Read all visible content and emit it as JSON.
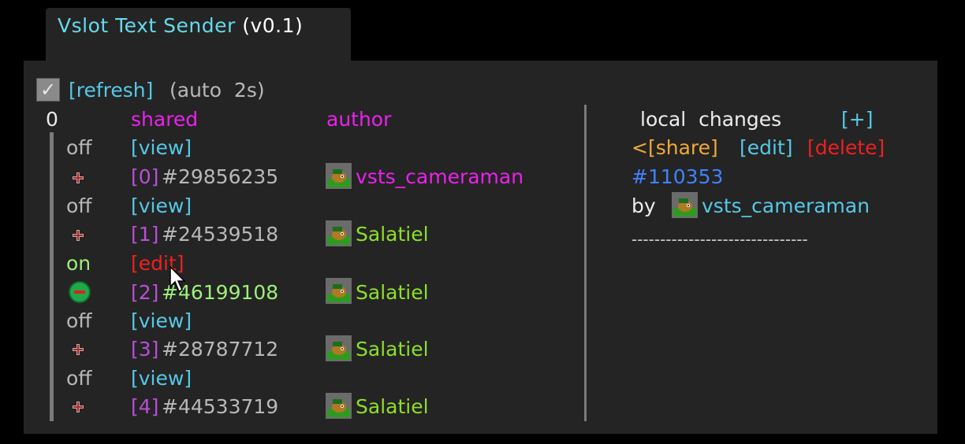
{
  "window": {
    "title": "Vslot Text Sender",
    "version": "(v0.1)"
  },
  "toolbar": {
    "refresh_label": "[refresh]",
    "auto_label": "(auto  2s)"
  },
  "list": {
    "index_label": "0",
    "header_shared": "shared",
    "header_author": "author",
    "rows": [
      {
        "state": "off",
        "action": "[view]",
        "slot": "[0]",
        "id": "#29856235",
        "author": "vsts_cameraman",
        "button": "plus-icon"
      },
      {
        "state": "off",
        "action": "[view]",
        "slot": "[1]",
        "id": "#24539518",
        "author": "Salatiel",
        "button": "plus-icon"
      },
      {
        "state": "on",
        "action": "[edit]",
        "slot": "[2]",
        "id": "#46199108",
        "author": "Salatiel",
        "button": "minus-icon"
      },
      {
        "state": "off",
        "action": "[view]",
        "slot": "[3]",
        "id": "#28787712",
        "author": "Salatiel",
        "button": "plus-icon"
      },
      {
        "state": "off",
        "action": "[view]",
        "slot": "[4]",
        "id": "#44533719",
        "author": "Salatiel",
        "button": "plus-icon"
      }
    ]
  },
  "local": {
    "title": "local  changes",
    "add_label": "[+]",
    "share_label": "<[share]",
    "edit_label": "[edit]",
    "delete_label": "[delete]",
    "id": "#110353",
    "by_label": "by",
    "author": "vsts_cameraman",
    "separator": "-------------------------------"
  },
  "colors": {
    "panel_bg": "#242424",
    "link_cyan": "#55c8e6",
    "author_magenta": "#ea22ea",
    "author_green": "#8ddf2a",
    "edit_red": "#ee2020",
    "share_orange": "#f2a838",
    "id_blue": "#3f82ff"
  }
}
